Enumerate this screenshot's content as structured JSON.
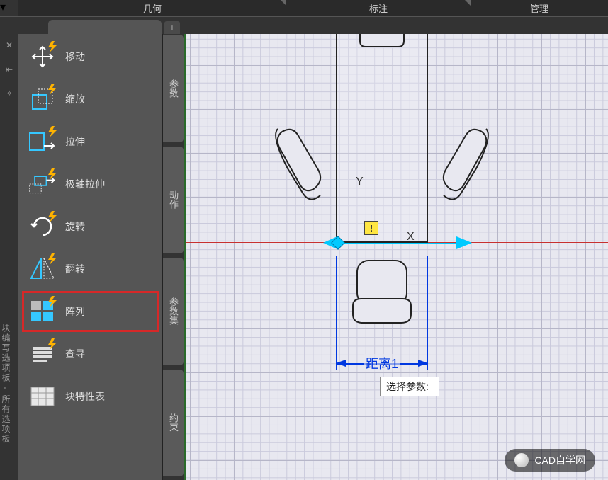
{
  "tabs": {
    "geometry": "几何",
    "annotate": "标注",
    "manage": "管理"
  },
  "side_tabs": {
    "params": "参数",
    "actions": "动作",
    "param_sets": "参数集",
    "constraints": "约束"
  },
  "tools": {
    "move": "移动",
    "scale": "缩放",
    "stretch": "拉伸",
    "polar_stretch": "极轴拉伸",
    "rotate": "旋转",
    "flip": "翻转",
    "array": "阵列",
    "lookup": "查寻",
    "block_table": "块特性表"
  },
  "canvas": {
    "axis_x": "X",
    "axis_y": "Y",
    "warn": "!",
    "dim_label": "距离1",
    "tooltip": "选择参数:"
  },
  "panel_title": "块编写选项板 - 所有选项板",
  "watermark": "CAD自学网",
  "add_tab": "+",
  "icons": {
    "move": "move-icon",
    "scale": "scale-icon",
    "stretch": "stretch-icon",
    "polar_stretch": "polar-stretch-icon",
    "rotate": "rotate-icon",
    "flip": "flip-icon",
    "array": "array-icon",
    "lookup": "lookup-icon",
    "block_table": "table-icon"
  },
  "colors": {
    "highlight": "#d62828",
    "param_arrow": "#00caff",
    "dim": "#0038e0"
  }
}
